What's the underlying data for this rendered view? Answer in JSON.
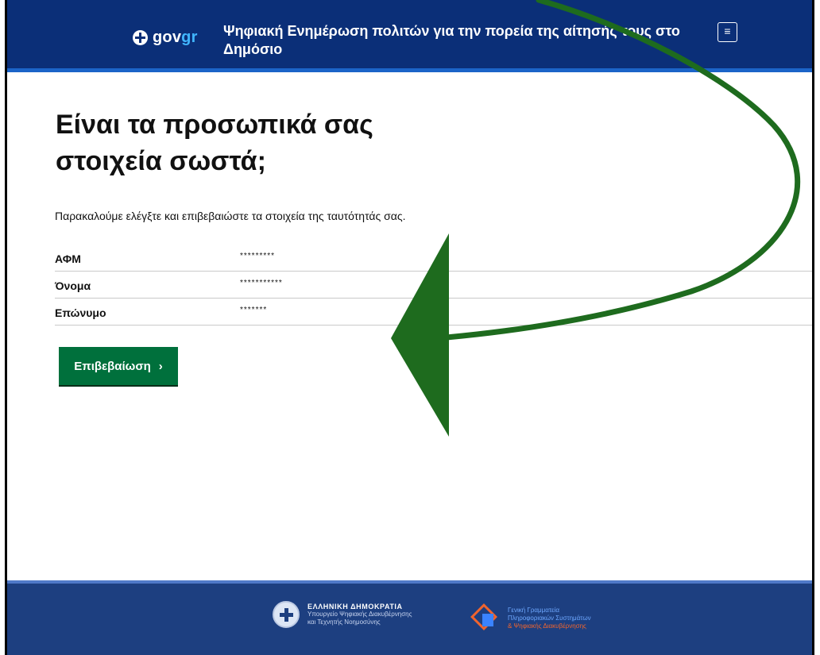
{
  "header": {
    "logo_text": "gov",
    "logo_text_accent": "gr",
    "title": "Ψηφιακή Ενημέρωση πολιτών για την πορεία της αίτησής τους στο Δημόσιο",
    "menu_label": "≡"
  },
  "main": {
    "heading": "Είναι τα προσωπικά σας στοιχεία σωστά;",
    "intro": "Παρακαλούμε ελέγξτε και επιβεβαιώστε τα στοιχεία της ταυτότητάς σας.",
    "details": [
      {
        "label": "ΑΦΜ",
        "value": "*********"
      },
      {
        "label": "Όνομα",
        "value": "***********"
      },
      {
        "label": "Επώνυμο",
        "value": "*******"
      }
    ],
    "confirm_button": "Επιβεβαίωση",
    "confirm_chevron": "›"
  },
  "footer": {
    "brand1_title": "ΕΛΛΗΝΙΚΗ ΔΗΜΟΚΡΑΤΙΑ",
    "brand1_sub1": "Υπουργείο Ψηφιακής Διακυβέρνησης",
    "brand1_sub2": "και Τεχνητής Νοημοσύνης",
    "brand2_line1": "Γενική Γραμματεία",
    "brand2_line2": "Πληροφοριακών Συστημάτων",
    "brand2_line3": "& Ψηφιακής Διακυβέρνησης"
  },
  "colors": {
    "header_bg": "#0b2f78",
    "header_accent": "#1b64c8",
    "button_green": "#00703c",
    "annotation_green": "#1e6b1e",
    "footer_bg": "#1d3f80"
  }
}
